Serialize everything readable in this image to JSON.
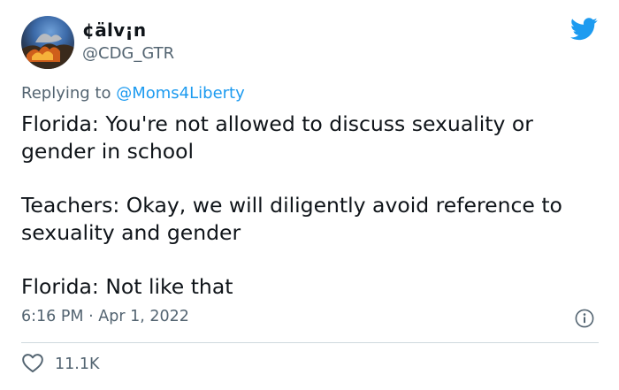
{
  "author": {
    "display_name": "¢älv¡n",
    "handle": "@CDG_GTR"
  },
  "reply": {
    "prefix": "Replying to ",
    "mention": "@Moms4Liberty"
  },
  "tweet": {
    "paragraphs": [
      "Florida: You're not allowed to discuss sexuality or gender in school",
      "Teachers: Okay, we will diligently avoid reference to sexuality and gender",
      "Florida: Not like that"
    ]
  },
  "meta": {
    "time": "6:16 PM",
    "separator": "·",
    "date": "Apr 1, 2022"
  },
  "engagement": {
    "likes": "11.1K"
  },
  "icons": {
    "brand": "twitter-bird-icon",
    "info": "info-icon",
    "like": "heart-icon"
  },
  "colors": {
    "brand_blue": "#1d9bf0",
    "secondary_text": "#536471",
    "primary_text": "#0f1419",
    "divider": "#cfd9de"
  }
}
